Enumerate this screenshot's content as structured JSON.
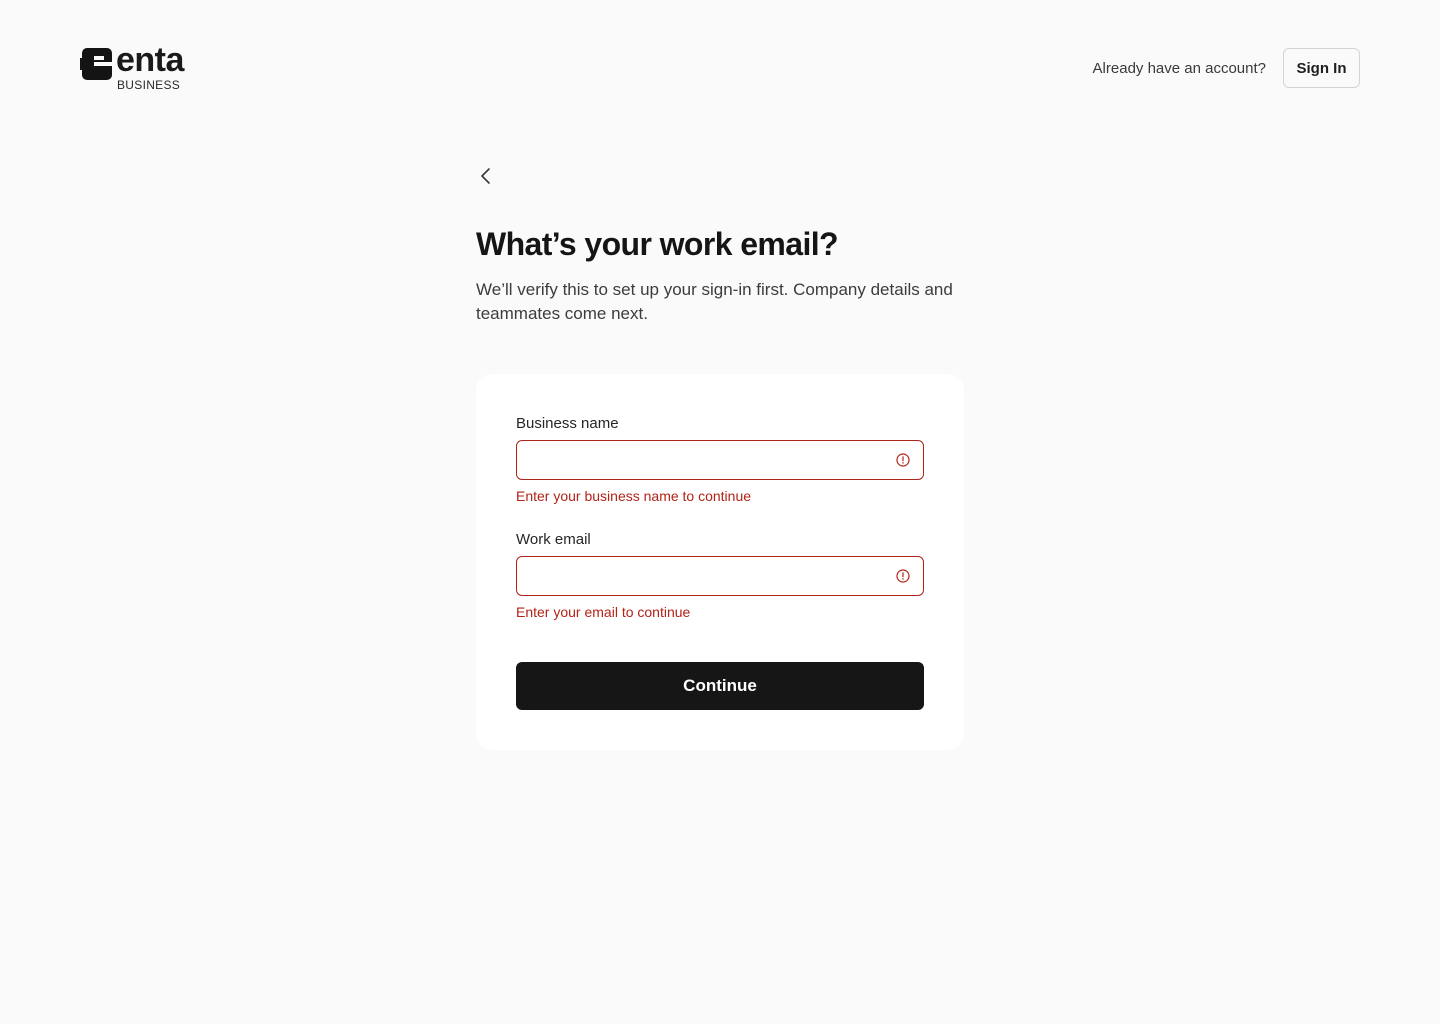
{
  "brand": {
    "name": "enta",
    "subtitle": "BUSINESS"
  },
  "header": {
    "already_text": "Already have an account?",
    "signin_label": "Sign In"
  },
  "main": {
    "back_icon": "chevron-left-icon",
    "title": "What’s your work email?",
    "subtitle": "We’ll verify this to set up your sign-in first. Company details and teammates come next."
  },
  "form": {
    "business_name": {
      "label": "Business name",
      "value": "",
      "error": "Enter your business name to continue",
      "icon": "alert-circle-icon"
    },
    "work_email": {
      "label": "Work email",
      "value": "",
      "error": "Enter your email to continue",
      "icon": "alert-circle-icon"
    },
    "continue_label": "Continue"
  },
  "colors": {
    "background": "#fafafa",
    "card": "#ffffff",
    "error": "#b42318",
    "primary_button": "#161616",
    "text": "#1a1a1a"
  }
}
